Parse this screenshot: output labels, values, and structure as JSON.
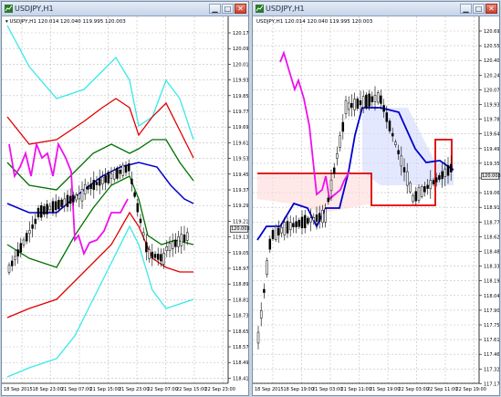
{
  "windows": [
    {
      "title": "USDJPY,H1",
      "info": "▾ USDJPY,H1  120.014 120.040 119.995 120.003",
      "price_tag": "120.003",
      "y_labels": [
        "120.170",
        "120.090",
        "120.010",
        "119.930",
        "119.850",
        "119.770",
        "119.690",
        "119.610",
        "119.530",
        "119.450",
        "119.370",
        "119.290",
        "119.210",
        "119.130",
        "119.050",
        "118.970",
        "118.890",
        "118.810",
        "118.730",
        "118.650",
        "118.570",
        "118.490",
        "118.410"
      ],
      "x_labels": [
        "18 Sep 2015",
        "18 Sep 23:00",
        "21 Sep 07:00",
        "21 Sep 15:00",
        "21 Sep 23:00",
        "22 Sep 07:00",
        "22 Sep 15:00",
        "22 Sep 23:00"
      ]
    },
    {
      "title": "USDJPY,H1",
      "info": "USDJPY,H1  120.014 120.040 119.995 120.003",
      "price_tag": "120.003",
      "y_labels": [
        "120.695",
        "120.550",
        "120.405",
        "120.245",
        "120.075",
        "119.930",
        "119.785",
        "119.640",
        "119.495",
        "119.350",
        "119.205",
        "119.060",
        "118.915",
        "118.770",
        "118.625",
        "118.480",
        "118.335",
        "118.190",
        "118.045",
        "117.900",
        "117.755",
        "117.610",
        "117.465",
        "117.320",
        "117.175"
      ],
      "x_labels": [
        "18 Sep 2015",
        "18 Sep 19:00",
        "21 Sep 03:00",
        "21 Sep 11:00",
        "21 Sep 19:00",
        "22 Sep 03:00",
        "22 Sep 11:00",
        "22 Sep 19:00"
      ]
    }
  ],
  "title_buttons": {
    "minimize": "▁",
    "maximize": "□",
    "close": "✕"
  },
  "colors": {
    "cyan": "#38e8e8",
    "red": "#e00000",
    "green": "#007000",
    "blue": "#0000cc",
    "magenta": "#ee10ee",
    "bull": "#ffffff",
    "bear": "#000000"
  }
}
